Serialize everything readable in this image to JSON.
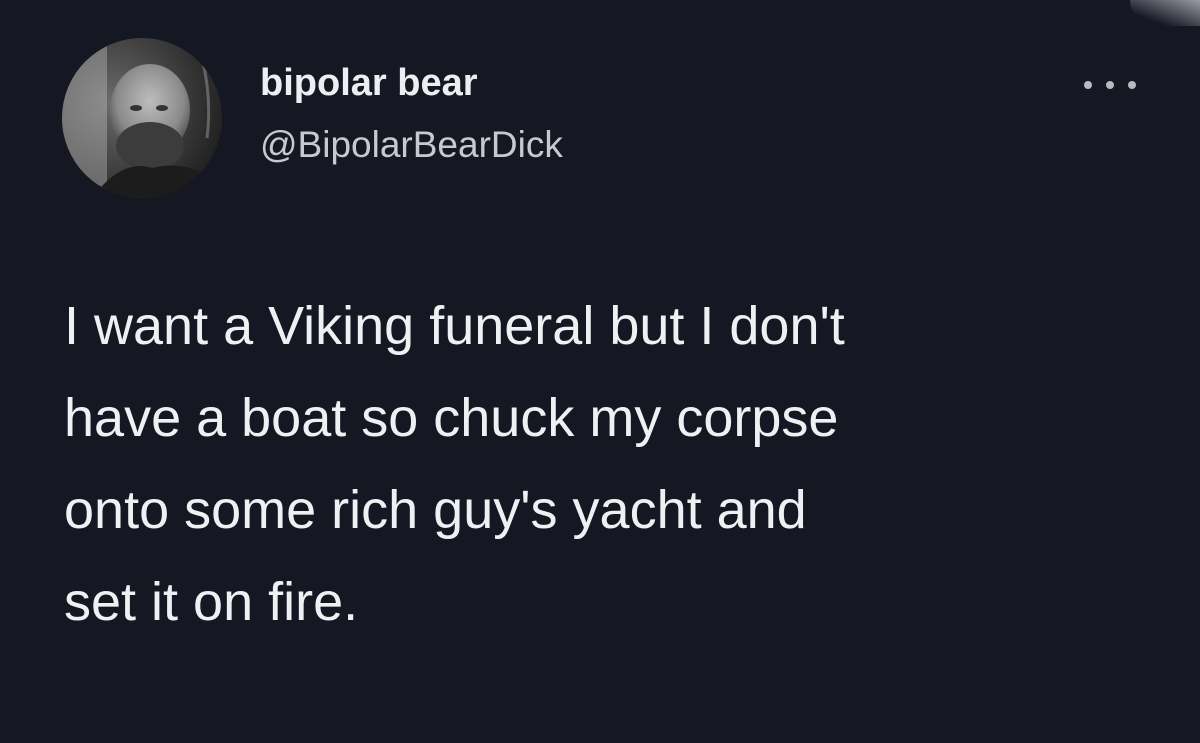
{
  "author": {
    "display_name": "bipolar bear",
    "handle": "@BipolarBearDick",
    "avatar_icon": "profile-photo"
  },
  "tweet": {
    "lines": [
      "I want a Viking funeral but I don't",
      "have a boat so chuck my corpse",
      "onto some rich guy's yacht and",
      "set it on fire."
    ]
  },
  "menu": {
    "icon": "more-options-icon"
  },
  "colors": {
    "background": "#151823",
    "text": "#eef0f2",
    "secondary_text": "#c7c9ce"
  }
}
